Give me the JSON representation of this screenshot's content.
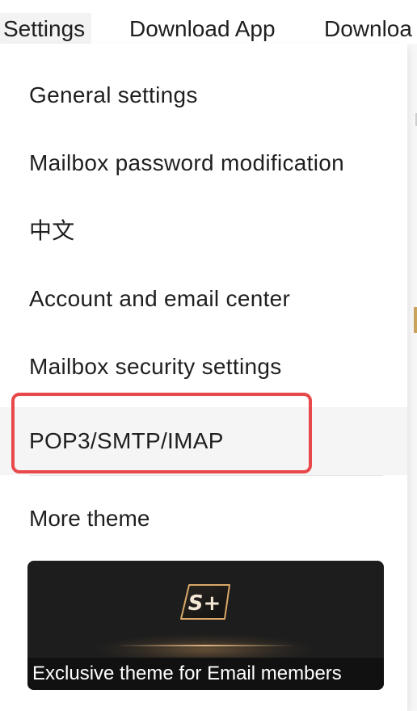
{
  "topnav": {
    "settings": "Settings",
    "download_app": "Download App",
    "download_truncated": "Downloa"
  },
  "menu": {
    "items": [
      {
        "label": "General settings"
      },
      {
        "label": "Mailbox password modification"
      },
      {
        "label": "中文"
      },
      {
        "label": "Account and email center"
      },
      {
        "label": "Mailbox security settings"
      },
      {
        "label": "POP3/SMTP/IMAP",
        "highlighted": true
      }
    ],
    "section_title": "More theme",
    "theme_card": {
      "badge_text": "S+",
      "caption": "Exclusive theme for Email members"
    }
  },
  "colors": {
    "highlight_border": "#e8484a",
    "hover_background": "#f5f5f5",
    "card_background": "#1d1d1d",
    "badge_gold": "#d9a868"
  }
}
